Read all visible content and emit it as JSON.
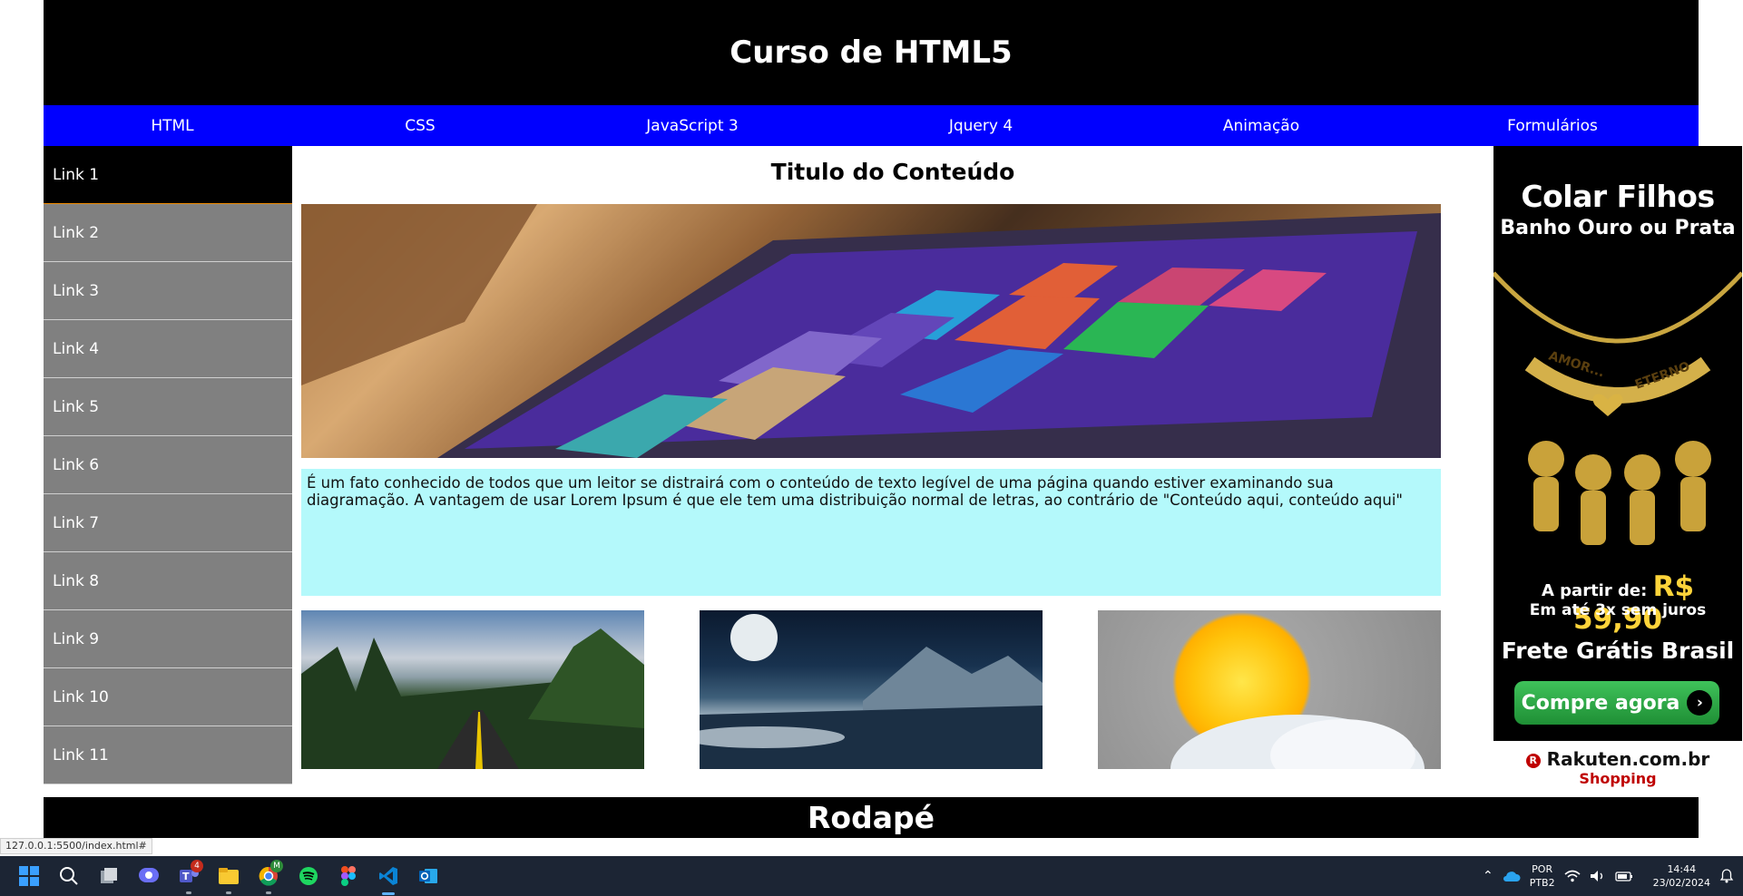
{
  "header": {
    "title": "Curso de HTML5"
  },
  "nav": {
    "items": [
      {
        "label": "HTML"
      },
      {
        "label": "CSS"
      },
      {
        "label": "JavaScript 3"
      },
      {
        "label": "Jquery 4"
      },
      {
        "label": "Animação"
      },
      {
        "label": "Formulários"
      }
    ]
  },
  "sidebar": {
    "links": [
      {
        "label": "Link 1"
      },
      {
        "label": "Link 2"
      },
      {
        "label": "Link 3"
      },
      {
        "label": "Link 4"
      },
      {
        "label": "Link 5"
      },
      {
        "label": "Link 6"
      },
      {
        "label": "Link 7"
      },
      {
        "label": "Link 8"
      },
      {
        "label": "Link 9"
      },
      {
        "label": "Link 10"
      },
      {
        "label": "Link 11"
      }
    ]
  },
  "content": {
    "title": "Titulo do Conteúdo",
    "paragraph": "É um fato conhecido de todos que um leitor se distrairá com o conteúdo de texto legível de uma página quando estiver examinando sua diagramação. A vantagem de usar Lorem Ipsum é que ele tem uma distribuição normal de letras, ao contrário de \"Conteúdo aqui, conteúdo aqui\""
  },
  "ad": {
    "title": "Colar Filhos",
    "subtitle": "Banho Ouro ou Prata",
    "necklace_text_left": "AMOR...",
    "necklace_text_right": "ETERNO",
    "from_label": "A partir de:",
    "price": "R$ 59,90",
    "installments": "Em até 3x sem juros",
    "shipping": "Frete Grátis Brasil",
    "button_label": "Compre agora",
    "brand": "Rakuten.com.br",
    "brand_sub": "Shopping"
  },
  "footer": {
    "label": "Rodapé"
  },
  "browser_status": {
    "url": "127.0.0.1:5500/index.html#"
  },
  "taskbar": {
    "icons": [
      "windows-start",
      "search",
      "task-view",
      "chat",
      "teams",
      "file-explorer",
      "chrome",
      "spotify",
      "figma",
      "vscode",
      "outlook"
    ],
    "teams_badge": "4",
    "chrome_badge": "M",
    "language_top": "POR",
    "language_bottom": "PTB2",
    "time": "14:44",
    "date": "23/02/2024"
  },
  "colors": {
    "header_bg": "#000000",
    "nav_bg": "#0000ff",
    "sidebar_bg": "#808080",
    "sidebar_active_bg": "#000000",
    "text_box_bg": "#b4f9fb",
    "ad_price": "#ffd43a"
  }
}
